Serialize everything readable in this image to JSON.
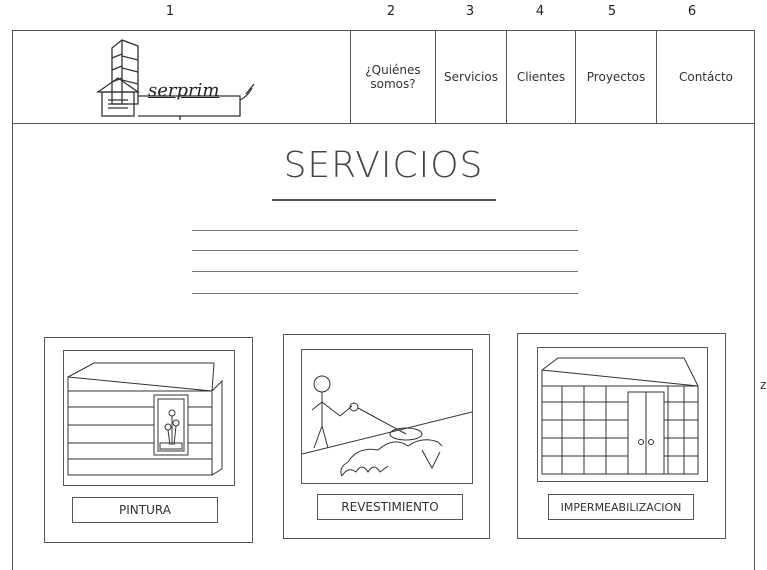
{
  "column_markers": [
    "1",
    "2",
    "3",
    "4",
    "5",
    "6"
  ],
  "logo": {
    "text": "serprim"
  },
  "nav": {
    "items": [
      {
        "label_line1": "¿Quiénes",
        "label_line2": "somos?"
      },
      {
        "label": "Servicios"
      },
      {
        "label": "Clientes"
      },
      {
        "label": "Proyectos"
      },
      {
        "label": "Contácto"
      }
    ]
  },
  "main": {
    "title": "SERVICIOS",
    "services": [
      {
        "label": "PINTURA",
        "image_icon": "painted-building-icon"
      },
      {
        "label": "REVESTIMIENTO",
        "image_icon": "plastering-worker-icon"
      },
      {
        "label": "IMPERMEABILIZACION",
        "image_icon": "waterproofed-building-icon"
      }
    ]
  },
  "edge_mark": "z"
}
